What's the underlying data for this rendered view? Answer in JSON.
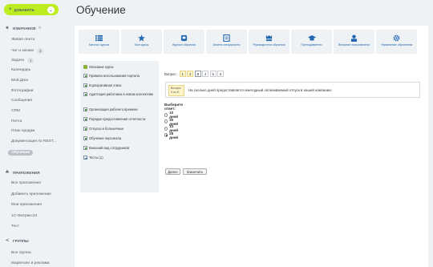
{
  "sidebar": {
    "add_button": "ДОБАВИТЬ",
    "favorites_header": "ИЗБРАННОЕ",
    "favorites": [
      {
        "label": "Живая лента"
      },
      {
        "label": "Чат и звонки",
        "count": "2"
      },
      {
        "label": "Задачи",
        "count": "1"
      },
      {
        "label": "Календарь"
      },
      {
        "label": "Мой Диск"
      },
      {
        "label": "Фотографии"
      },
      {
        "label": "Сообщения"
      },
      {
        "label": "CRM"
      },
      {
        "label": "Почта"
      },
      {
        "label": "План продаж"
      },
      {
        "label": "Документация по REST..."
      },
      {
        "label": "Обучение"
      }
    ],
    "apps_header": "ПРИЛОЖЕНИЯ",
    "apps": [
      {
        "label": "Все приложения"
      },
      {
        "label": "Добавить приложение"
      },
      {
        "label": "Мои приложения"
      },
      {
        "label": "1С+Битрикс24"
      },
      {
        "label": "Тест"
      }
    ],
    "groups_header": "ГРУППЫ",
    "groups": [
      {
        "label": "Все группы"
      },
      {
        "label": "Маркетинг и реклама"
      }
    ]
  },
  "page": {
    "title": "Обучение"
  },
  "toolbar": [
    {
      "label": "Каталог курсов",
      "icon": "list-icon"
    },
    {
      "label": "Мои курсы",
      "icon": "star-icon"
    },
    {
      "label": "Журнал обучения",
      "icon": "journal-icon"
    },
    {
      "label": "Анкета специалиста",
      "icon": "form-icon"
    },
    {
      "label": "Руководители обучения",
      "icon": "leaders-icon"
    },
    {
      "label": "Преподаватели",
      "icon": "graduation-cap-icon"
    },
    {
      "label": "Внешние пользователи",
      "icon": "user-icon"
    },
    {
      "label": "Управление обучением",
      "icon": "gear-icon"
    }
  ],
  "course_menu": [
    {
      "label": "Описание курса",
      "icon": "book"
    },
    {
      "label": "Правила использования портала",
      "icon": "doc"
    },
    {
      "label": "Корпоративная этика",
      "icon": "doc"
    },
    {
      "label": "Адаптация работника в новом коллективе",
      "icon": "doc"
    },
    {
      "label": "Организация рабочего времени",
      "icon": "doc"
    },
    {
      "label": "Порядок предоставления отчетности",
      "icon": "doc"
    },
    {
      "label": "Отпуска и больничные",
      "icon": "doc"
    },
    {
      "label": "Обучение персонала",
      "icon": "doc"
    },
    {
      "label": "Внешний вид сотрудников",
      "icon": "doc"
    },
    {
      "label": "Тесты (1)",
      "icon": "test"
    }
  ],
  "question": {
    "nav_label": "Вопрос:",
    "numbers": [
      "1",
      "2",
      "3",
      "4",
      "5",
      "6"
    ],
    "current": "3",
    "tag_line1": "Вопрос",
    "tag_line2": "3 из 6",
    "text": "На сколько дней предоставляется ежегодный оплачиваемый отпуск в нашей компании:",
    "choose_label": "Выберите ответ:",
    "options": [
      "10 дней",
      "30 дней",
      "14 дней",
      "28 дней"
    ],
    "selected_index": 3,
    "next_button": "Далее",
    "finish_button": "Закончить"
  },
  "colors": {
    "accent": "#bbed21",
    "link": "#2067b0",
    "icon": "#2067b0"
  }
}
